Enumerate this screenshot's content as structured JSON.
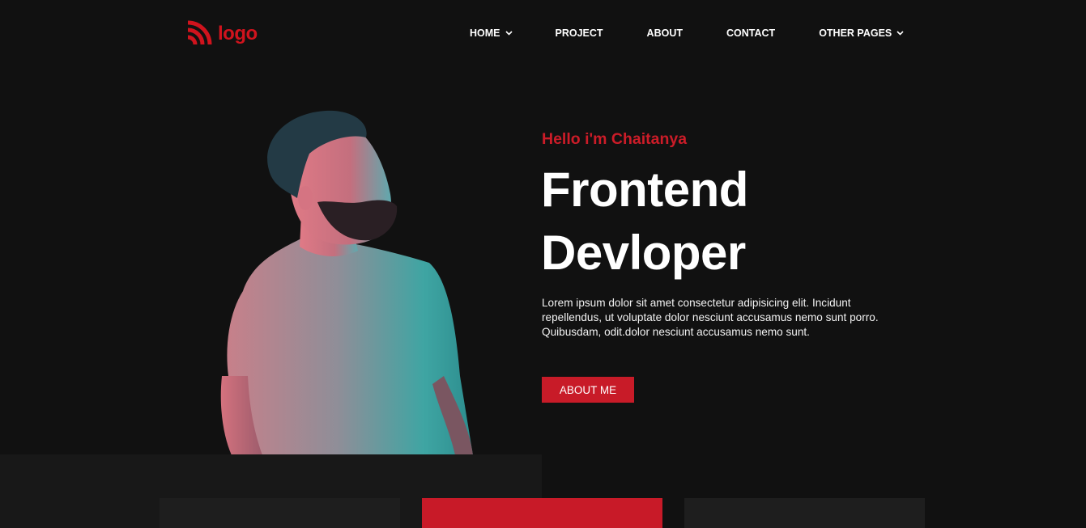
{
  "header": {
    "logo_text": "logo",
    "logo_icon": "wifi-signal-icon",
    "nav": [
      {
        "label": "HOME",
        "has_dropdown": true
      },
      {
        "label": "PROJECT",
        "has_dropdown": false
      },
      {
        "label": "ABOUT",
        "has_dropdown": false
      },
      {
        "label": "CONTACT",
        "has_dropdown": false
      },
      {
        "label": "OTHER PAGES",
        "has_dropdown": true
      }
    ]
  },
  "hero": {
    "greeting": "Hello i'm Chaitanya",
    "title_line1": "Frontend",
    "title_line2": "Devloper",
    "description": "Lorem ipsum dolor sit amet consectetur adipisicing elit. Incidunt repellendus, ut voluptate dolor nesciunt accusamus nemo sunt porro. Quibusdam, odit.dolor nesciunt accusamus nemo sunt.",
    "button_label": "ABOUT ME",
    "photo": "portrait-photo"
  },
  "colors": {
    "background": "#111111",
    "accent": "#c81b28",
    "text": "#ffffff",
    "panel": "#1e1e1e"
  }
}
